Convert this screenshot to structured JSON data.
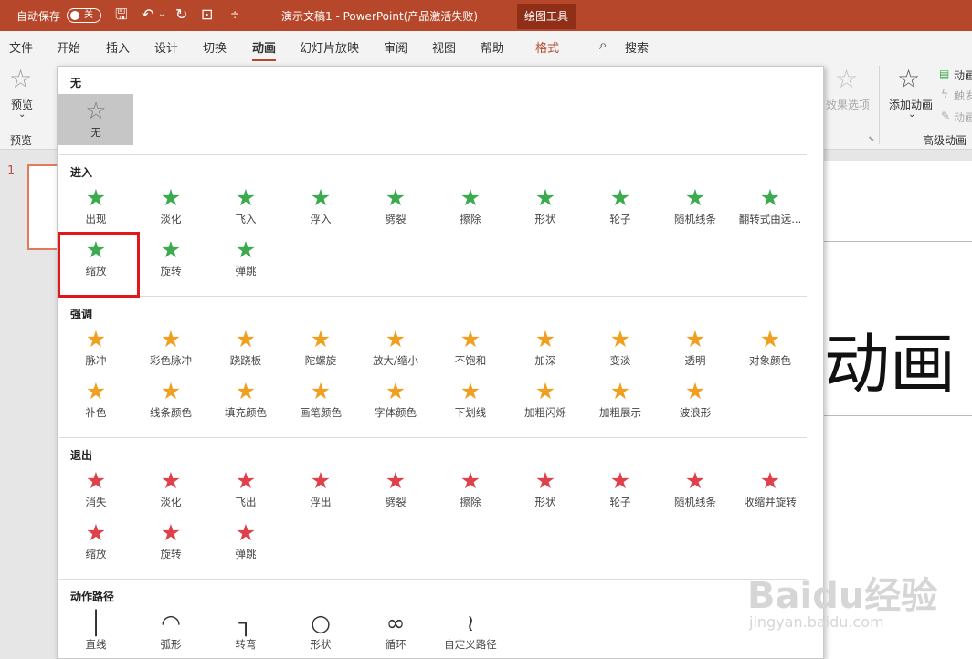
{
  "titlebar": {
    "autosave_label": "自动保存",
    "autosave_state": "关",
    "doc_title": "演示文稿1  -  PowerPoint(产品激活失败)",
    "context_tab": "绘图工具"
  },
  "menu": [
    "文件",
    "开始",
    "插入",
    "设计",
    "切换",
    "动画",
    "幻灯片放映",
    "审阅",
    "视图",
    "帮助",
    "格式"
  ],
  "search_label": "搜索",
  "ribbon": {
    "preview_button": "预览",
    "preview_group": "预览",
    "effect_options": "效果选项",
    "add_animation": "添加动画",
    "advanced_group": "高级动画",
    "right_items": [
      "动画",
      "触发",
      "动画"
    ]
  },
  "slide": {
    "number": "1",
    "text": "动画"
  },
  "gallery": {
    "none_section": "无",
    "none_item": "无",
    "entrance_section": "进入",
    "entrance_items": [
      "出现",
      "淡化",
      "飞入",
      "浮入",
      "劈裂",
      "擦除",
      "形状",
      "轮子",
      "随机线条",
      "翻转式由远...",
      "缩放",
      "旋转",
      "弹跳"
    ],
    "emphasis_section": "强调",
    "emphasis_items": [
      "脉冲",
      "彩色脉冲",
      "跷跷板",
      "陀螺旋",
      "放大/缩小",
      "不饱和",
      "加深",
      "变淡",
      "透明",
      "对象颜色",
      "补色",
      "线条颜色",
      "填充颜色",
      "画笔颜色",
      "字体颜色",
      "下划线",
      "加粗闪烁",
      "加粗展示",
      "波浪形"
    ],
    "exit_section": "退出",
    "exit_items": [
      "消失",
      "淡化",
      "飞出",
      "浮出",
      "劈裂",
      "擦除",
      "形状",
      "轮子",
      "随机线条",
      "收缩并旋转",
      "缩放",
      "旋转",
      "弹跳"
    ],
    "motion_section": "动作路径",
    "motion_items": [
      "直线",
      "弧形",
      "转弯",
      "形状",
      "循环",
      "自定义路径"
    ]
  },
  "colors": {
    "entrance": "#3cab4f",
    "emphasis": "#f0a020",
    "exit": "#e0404a",
    "accent": "#b7472a"
  },
  "watermark": {
    "line1": "Baidu经验",
    "line2": "jingyan.baidu.com"
  }
}
